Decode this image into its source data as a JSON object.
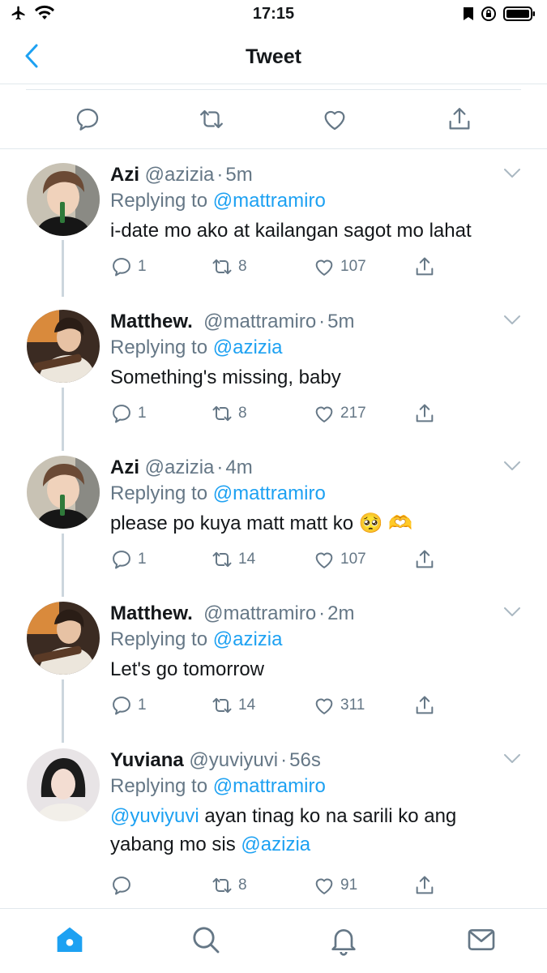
{
  "status_bar": {
    "time": "17:15"
  },
  "nav": {
    "title": "Tweet"
  },
  "colors": {
    "accent": "#1da1f2",
    "secondary_text": "#657786",
    "divider": "#e1e8ed"
  },
  "replies": [
    {
      "name": "Azi",
      "handle": "@azizia",
      "time": "5m",
      "replying_label": "Replying to",
      "replying_to": "@mattramiro",
      "text": "i-date mo ako at kailangan sagot mo lahat",
      "reply_count": "1",
      "retweet_count": "8",
      "like_count": "107"
    },
    {
      "name": "Matthew.",
      "handle": "@mattramiro",
      "time": "5m",
      "replying_label": "Replying to",
      "replying_to": "@azizia",
      "text": "Something's missing, baby",
      "reply_count": "1",
      "retweet_count": "8",
      "like_count": "217"
    },
    {
      "name": "Azi",
      "handle": "@azizia",
      "time": "4m",
      "replying_label": "Replying to",
      "replying_to": "@mattramiro",
      "text": "please po kuya matt matt ko 🥺 🫶",
      "reply_count": "1",
      "retweet_count": "14",
      "like_count": "107"
    },
    {
      "name": "Matthew.",
      "handle": "@mattramiro",
      "time": "2m",
      "replying_label": "Replying to",
      "replying_to": "@azizia",
      "text": "Let's go tomorrow",
      "reply_count": "1",
      "retweet_count": "14",
      "like_count": "311"
    },
    {
      "name": "Yuviana",
      "handle": "@yuviyuvi",
      "time": "56s",
      "replying_label": "Replying to",
      "replying_to": "@mattramiro",
      "text_mention_1": "@yuviyuvi",
      "text_middle": " ayan tinag ko na sarili ko ang yabang mo sis ",
      "text_mention_2": "@azizia",
      "reply_count": "",
      "retweet_count": "8",
      "like_count": "91"
    }
  ]
}
